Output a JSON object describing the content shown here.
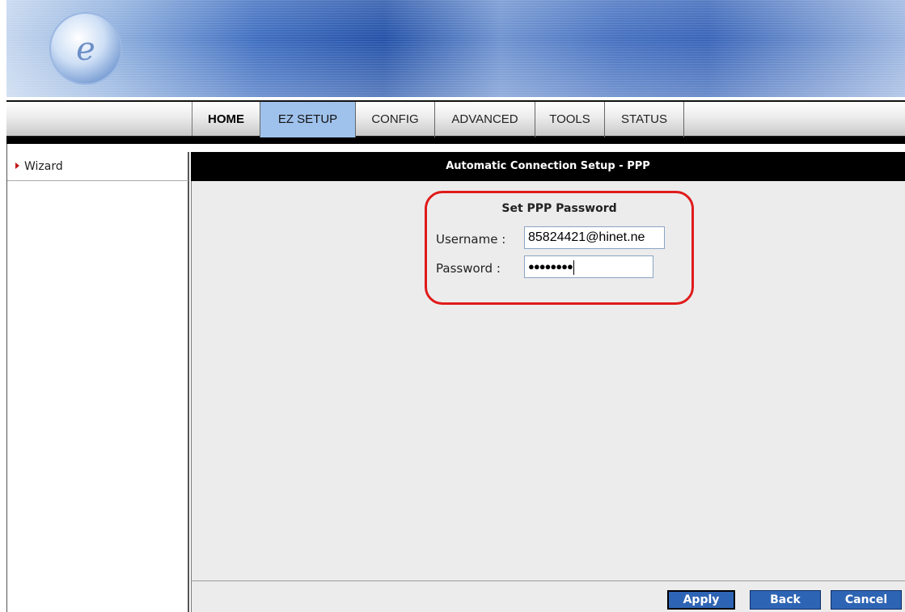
{
  "header": {
    "logo_icon": "e-globe-logo-icon"
  },
  "nav": {
    "tabs": [
      {
        "label": "HOME"
      },
      {
        "label": "EZ SETUP"
      },
      {
        "label": "CONFIG"
      },
      {
        "label": "ADVANCED"
      },
      {
        "label": "TOOLS"
      },
      {
        "label": "STATUS"
      }
    ],
    "active_tab": "EZ SETUP"
  },
  "sidebar": {
    "items": [
      {
        "label": "Wizard",
        "icon": "red-triangle-arrow-icon"
      }
    ]
  },
  "main": {
    "title": "Automatic Connection Setup - PPP",
    "form": {
      "heading": "Set PPP Password",
      "username_label": "Username :",
      "username_value": "85824421@hinet.ne",
      "password_label": "Password :",
      "password_value": "●●●●●●●●"
    }
  },
  "footer": {
    "apply_label": "Apply",
    "back_label": "Back",
    "cancel_label": "Cancel"
  },
  "colors": {
    "accent": "#2e64b4",
    "active_tab": "#9fc2ec",
    "highlight": "#e01b1b"
  }
}
